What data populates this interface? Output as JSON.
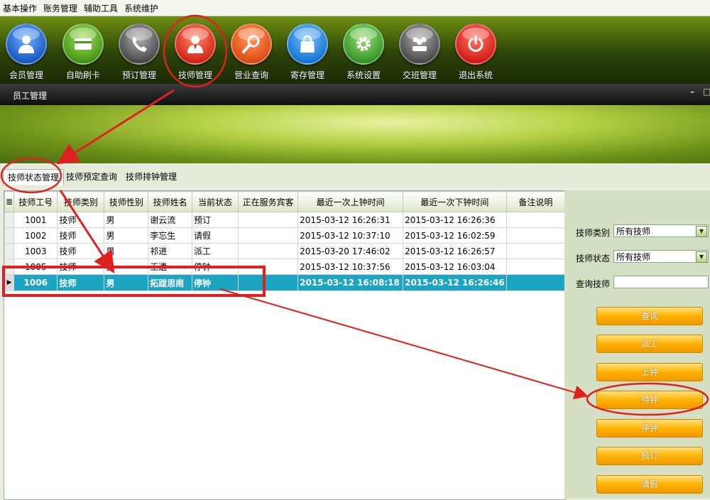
{
  "menu": [
    "基本操作",
    "账务管理",
    "辅助工具",
    "系统维护"
  ],
  "tools": [
    {
      "label": "会员管理",
      "icon": "member-icon",
      "color": "#2a6fd6"
    },
    {
      "label": "自助刷卡",
      "icon": "card-icon",
      "color": "#4a9a1a"
    },
    {
      "label": "预订管理",
      "icon": "phone-icon",
      "color": "#555555"
    },
    {
      "label": "技师管理",
      "icon": "technician-icon",
      "color": "#d62a1a"
    },
    {
      "label": "营业查询",
      "icon": "search-icon",
      "color": "#e0501a"
    },
    {
      "label": "寄存管理",
      "icon": "bag-icon",
      "color": "#1a7ad6"
    },
    {
      "label": "系统设置",
      "icon": "gear-icon",
      "color": "#3a9a2a"
    },
    {
      "label": "交班管理",
      "icon": "people-icon",
      "color": "#555555"
    },
    {
      "label": "退出系统",
      "icon": "power-icon",
      "color": "#d6201a"
    }
  ],
  "window": {
    "title": "员工管理"
  },
  "tabs": [
    "技师状态管理",
    "技师预定查询",
    "技师排钟管理"
  ],
  "table": {
    "headers": [
      "技师工号",
      "技师类别",
      "技师性别",
      "技师姓名",
      "当前状态",
      "正在服务宾客",
      "最近一次上钟时间",
      "最近一次下钟时间",
      "备注说明"
    ],
    "rows": [
      [
        "1001",
        "技师",
        "男",
        "谢云流",
        "预订",
        "",
        "2015-03-12 16:26:31",
        "2015-03-12 16:26:36",
        ""
      ],
      [
        "1002",
        "技师",
        "男",
        "李忘生",
        "请假",
        "",
        "2015-03-12 10:37:10",
        "2015-03-12 16:02:59",
        ""
      ],
      [
        "1003",
        "技师",
        "男",
        "祁进",
        "派工",
        "",
        "2015-03-20 17:46:02",
        "2015-03-12 16:26:57",
        ""
      ],
      [
        "1005",
        "技师",
        "男",
        "王遗",
        "停钟",
        "",
        "2015-03-12 10:37:56",
        "2015-03-12 16:03:04",
        ""
      ],
      [
        "1006",
        "技师",
        "男",
        "拓跋思南",
        "停钟",
        "",
        "2015-03-12 16:08:18",
        "2015-03-12 16:26:46",
        ""
      ]
    ],
    "selected_row": 4
  },
  "filters": {
    "type_label": "技师类别",
    "type_value": "所有技师",
    "status_label": "技师状态",
    "status_value": "所有技师",
    "search_label": "查询技师"
  },
  "buttons": [
    "查询",
    "派工",
    "上钟",
    "待钟",
    "停钟",
    "预订",
    "请假"
  ],
  "annotation_color": "#e02020"
}
